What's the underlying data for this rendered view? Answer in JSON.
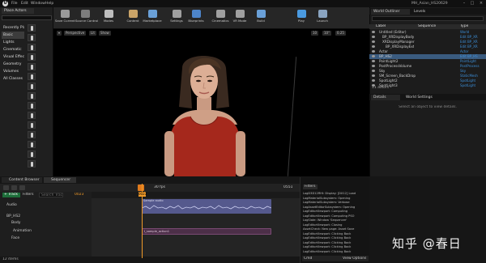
{
  "app": {
    "logo": "U",
    "menu": [
      "File",
      "Edit",
      "Window",
      "Help"
    ],
    "project_title": "MH_Asian_HS20629"
  },
  "place_actors": {
    "tab_label": "Place Actors",
    "categories": [
      "Recently Placed",
      "Basic",
      "Lights",
      "Cinematic",
      "Visual Effects",
      "Geometry",
      "Volumes",
      "All Classes"
    ],
    "selected_category": "Basic"
  },
  "toolbar": {
    "buttons": [
      {
        "label": "Save Current",
        "icon": "save-icon",
        "color": "#9a9a9a"
      },
      {
        "label": "Source Control",
        "icon": "source-control-icon",
        "color": "#7d7d7d"
      },
      {
        "label": "Modes",
        "icon": "modes-icon",
        "color": "#bdbdbd"
      },
      {
        "label": "Content",
        "icon": "content-icon",
        "color": "#caa468"
      },
      {
        "label": "Marketplace",
        "icon": "marketplace-icon",
        "color": "#6aa0d8"
      },
      {
        "label": "Settings",
        "icon": "settings-icon",
        "color": "#a0a0a0"
      },
      {
        "label": "Blueprints",
        "icon": "blueprints-icon",
        "color": "#4d84c9"
      },
      {
        "label": "Cinematics",
        "icon": "cinematics-icon",
        "color": "#a0a0a0"
      },
      {
        "label": "VR Mode",
        "icon": "vr-icon",
        "color": "#a0a0a0"
      },
      {
        "label": "Build",
        "icon": "build-icon",
        "color": "#6aa0d8"
      },
      {
        "label": "Play",
        "icon": "play-icon",
        "color": "#4a9ae0"
      },
      {
        "label": "Launch",
        "icon": "launch-icon",
        "color": "#8aa4c0"
      }
    ]
  },
  "viewport": {
    "perspective_label": "Perspective",
    "lit_label": "Lit",
    "show_label": "Show",
    "grid_value": "10",
    "angle_value": "10°",
    "scale_value": "0.25"
  },
  "world_outliner": {
    "tabs": [
      "World Outliner",
      "Levels"
    ],
    "columns": {
      "label": "Label",
      "sequence": "Sequence",
      "type": "Type"
    },
    "rows": [
      {
        "label": "Untitled (Editor)",
        "type": "World"
      },
      {
        "label": "BP_XRDisplayBody",
        "type": "Edit BP_XR"
      },
      {
        "label": "XRDisplayManager",
        "type": "Edit BP_XR"
      },
      {
        "label": "BP_XRDisplayExt",
        "type": "Edit BP_XR"
      },
      {
        "label": "Actor",
        "type": "Actor"
      },
      {
        "label": "BP_HS2",
        "type": "Edit BP_HS"
      },
      {
        "label": "PointLight2",
        "type": "PointLight"
      },
      {
        "label": "PostProcessVolume",
        "type": "PostProcess"
      },
      {
        "label": "Sky",
        "type": "Sky"
      },
      {
        "label": "SM_Screen_BackDrop",
        "type": "StaticMesh"
      },
      {
        "label": "SpotLight2",
        "type": "SpotLight"
      },
      {
        "label": "SpotLight3",
        "type": "SpotLight"
      }
    ],
    "selected_row": "BP_HS2",
    "actors_count": "11 actors"
  },
  "details": {
    "tabs": [
      "Details",
      "World Settings"
    ],
    "empty_text": "Select an object to view details."
  },
  "bottom": {
    "tabs": [
      "Content Browser",
      "Sequencer",
      "Output Log"
    ],
    "seq_frame": "0023",
    "seq_fps": "30 fps",
    "seq_end": "0551",
    "track_label": "+ Track",
    "filters_label": "Filters",
    "search_placeholder": "Search Tracks",
    "tracks": [
      "Audio",
      "BP_HS2",
      "Body",
      "Animation",
      "Face"
    ],
    "anim_clip": "I_sample_action1",
    "audio_clip": "Sample audio",
    "items_count": "12 items",
    "log_lines": [
      "LogD3D12RHI: Display: [DX12] Load",
      "LogMaterialSubsystem: Opening",
      "LogMaterialSubsystem: Verbose",
      "LogAssetEditorSubsystem: Opening",
      "LogEditorViewport: Computing",
      "LogEditorViewport: Computing PSO",
      "LogSlate: Window 'Sequencer'",
      "LogEditorViewport: Closing",
      "AssetCheck: New page: Asset Save",
      "LogEditorViewport: Clicking Back",
      "LogEditorViewport: Clicking Back",
      "LogEditorViewport: Clicking Back",
      "LogEditorViewport: Clicking Back",
      "LogEditorViewport: Clicking Back"
    ],
    "cmd_label": "Cmd",
    "view_options": "View Options"
  },
  "watermark": {
    "text": "知乎 @春日"
  }
}
